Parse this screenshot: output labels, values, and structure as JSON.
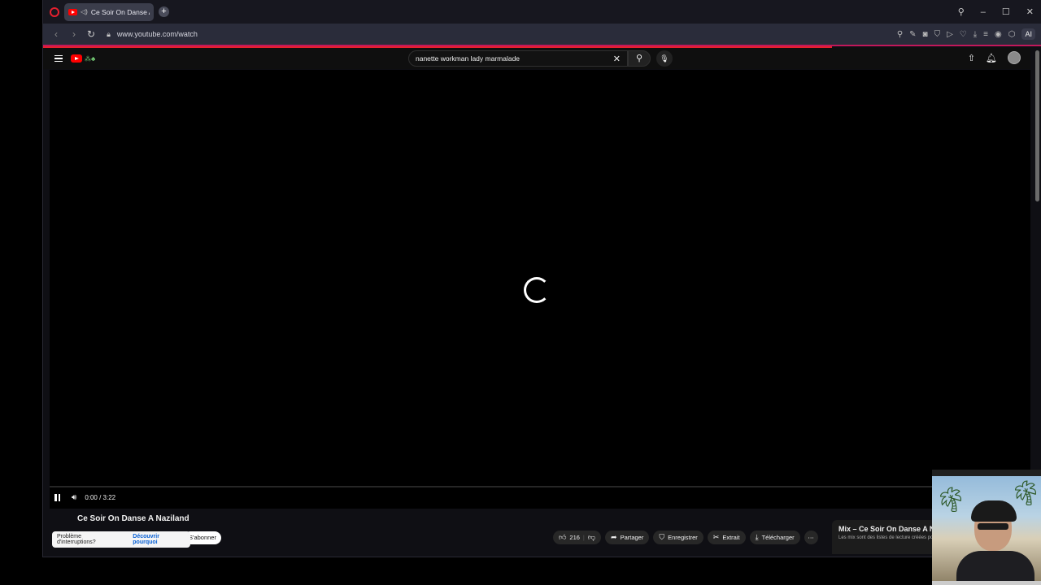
{
  "browser": {
    "tab_title": "Ce Soir On Danse A N",
    "new_tab_label": "+",
    "url": "www.youtube.com/watch",
    "ai_label": "AI",
    "win_controls": [
      "search-icon",
      "minimize-icon",
      "maximize-icon",
      "close-icon"
    ],
    "toolbar_icons": [
      "lens-icon",
      "edit-icon",
      "camera-icon",
      "shield-icon",
      "play-icon",
      "heart-icon",
      "download-icon",
      "menu-icon",
      "profile-icon",
      "cube-icon"
    ]
  },
  "youtube": {
    "search_query": "nanette workman lady marmalade",
    "video": {
      "state": "loading",
      "time": "0:00 / 3:22",
      "title": "Ce Soir On Danse A Naziland"
    },
    "toast": {
      "text": "Problème d'interruptions?",
      "link": "Découvrir pourquoi"
    },
    "subscribe_label": "S'abonner",
    "actions": {
      "likes": "216",
      "share": "Partager",
      "save": "Enregistrer",
      "clip": "Extrait",
      "download": "Télécharger",
      "more": "⋯"
    },
    "mix": {
      "title": "Mix – Ce Soir On Danse A N",
      "subtitle": "Les mix sont des listes de lecture créées po"
    }
  },
  "colors": {
    "accent": "#e5202e",
    "youtube_red": "#ff0000",
    "background": "#0f0f0f"
  }
}
